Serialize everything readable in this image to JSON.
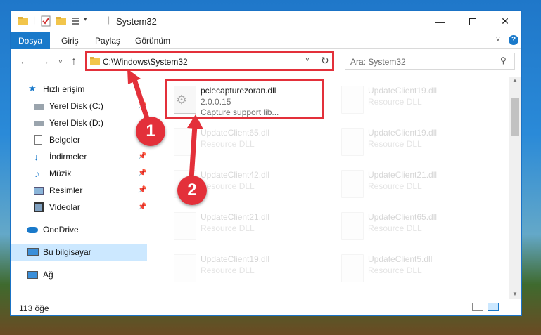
{
  "window": {
    "title": "System32"
  },
  "ribbon": {
    "tabs": [
      "Dosya",
      "Giriş",
      "Paylaş",
      "Görünüm"
    ]
  },
  "nav": {
    "address": "C:\\Windows\\System32",
    "search_placeholder": "Ara: System32"
  },
  "sidebar": {
    "items": [
      {
        "label": "Hızlı erişim",
        "icon": "star-icon"
      },
      {
        "label": "Yerel Disk (C:)",
        "icon": "drive-icon"
      },
      {
        "label": "Yerel Disk (D:)",
        "icon": "drive-icon"
      },
      {
        "label": "Belgeler",
        "icon": "documents-icon"
      },
      {
        "label": "İndirmeler",
        "icon": "download-icon"
      },
      {
        "label": "Müzik",
        "icon": "music-icon"
      },
      {
        "label": "Resimler",
        "icon": "pictures-icon"
      },
      {
        "label": "Videolar",
        "icon": "videos-icon"
      },
      {
        "label": "OneDrive",
        "icon": "cloud-icon"
      },
      {
        "label": "Bu bilgisayar",
        "icon": "computer-icon"
      },
      {
        "label": "Ağ",
        "icon": "network-icon"
      }
    ]
  },
  "files": [
    {
      "name": "pclecapturezoran.dll",
      "version": "2.0.0.15",
      "desc": "Capture support lib..."
    },
    {
      "name": "UpdateClient19.dll",
      "desc": "Resource DLL"
    },
    {
      "name": "UpdateClient65.dll",
      "desc": "Resource DLL"
    },
    {
      "name": "UpdateClient19.dll",
      "desc": "Resource DLL"
    },
    {
      "name": "UpdateClient42.dll",
      "desc": "Resource DLL"
    },
    {
      "name": "UpdateClient21.dll",
      "desc": "Resource DLL"
    },
    {
      "name": "UpdateClient21.dll",
      "desc": "Resource DLL"
    },
    {
      "name": "UpdateClient65.dll",
      "desc": "Resource DLL"
    },
    {
      "name": "UpdateClient19.dll",
      "desc": "Resource DLL"
    },
    {
      "name": "UpdateClient5.dll",
      "desc": "Resource DLL"
    }
  ],
  "status": {
    "count": "113 öğe"
  },
  "annotations": {
    "step1": "1",
    "step2": "2",
    "color": "#e3303a"
  }
}
